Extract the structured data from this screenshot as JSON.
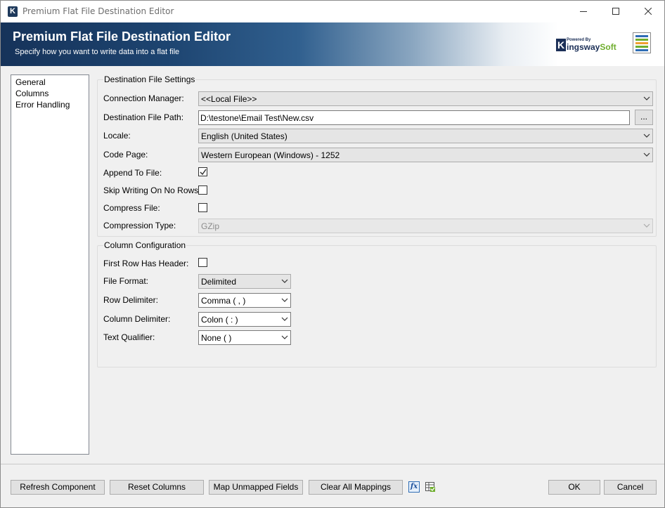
{
  "window": {
    "title": "Premium Flat File Destination Editor",
    "app_icon_letter": "K"
  },
  "banner": {
    "title": "Premium Flat File Destination Editor",
    "subtitle": "Specify how you want to write data into a flat file",
    "brand_powered": "Powered By",
    "brand_k": "K",
    "brand_name": "ingsway",
    "brand_soft": "Soft"
  },
  "nav": {
    "items": [
      {
        "label": "General"
      },
      {
        "label": "Columns"
      },
      {
        "label": "Error Handling"
      }
    ]
  },
  "destination": {
    "group_title": "Destination File Settings",
    "connection_manager": {
      "label": "Connection Manager:",
      "value": "<<Local File>>"
    },
    "file_path": {
      "label": "Destination File Path:",
      "value": "D:\\testone\\Email Test\\New.csv",
      "browse_label": "..."
    },
    "locale": {
      "label": "Locale:",
      "value": "English (United States)"
    },
    "code_page": {
      "label": "Code Page:",
      "value": "Western European (Windows) - 1252"
    },
    "append_to_file": {
      "label": "Append To File:",
      "checked": true
    },
    "skip_writing": {
      "label": "Skip Writing On No Rows:",
      "checked": false
    },
    "compress_file": {
      "label": "Compress File:",
      "checked": false
    },
    "compression_type": {
      "label": "Compression Type:",
      "value": "GZip",
      "disabled": true
    }
  },
  "columns": {
    "group_title": "Column Configuration",
    "first_row_header": {
      "label": "First Row Has Header:",
      "checked": false
    },
    "file_format": {
      "label": "File Format:",
      "value": "Delimited"
    },
    "row_delimiter": {
      "label": "Row Delimiter:",
      "value": "Comma ( , )"
    },
    "column_delimiter": {
      "label": "Column Delimiter:",
      "value": "Colon ( : )"
    },
    "text_qualifier": {
      "label": "Text Qualifier:",
      "value": "None (  )"
    }
  },
  "footer": {
    "refresh_label": "Refresh Component",
    "reset_label": "Reset Columns",
    "map_label": "Map Unmapped Fields",
    "clear_label": "Clear All Mappings",
    "ok_label": "OK",
    "cancel_label": "Cancel",
    "fx_icon_text": "fx"
  },
  "colors": {
    "banner_dark": "#16335a",
    "brand_navy": "#1b2f57",
    "brand_green": "#6fae2e"
  }
}
